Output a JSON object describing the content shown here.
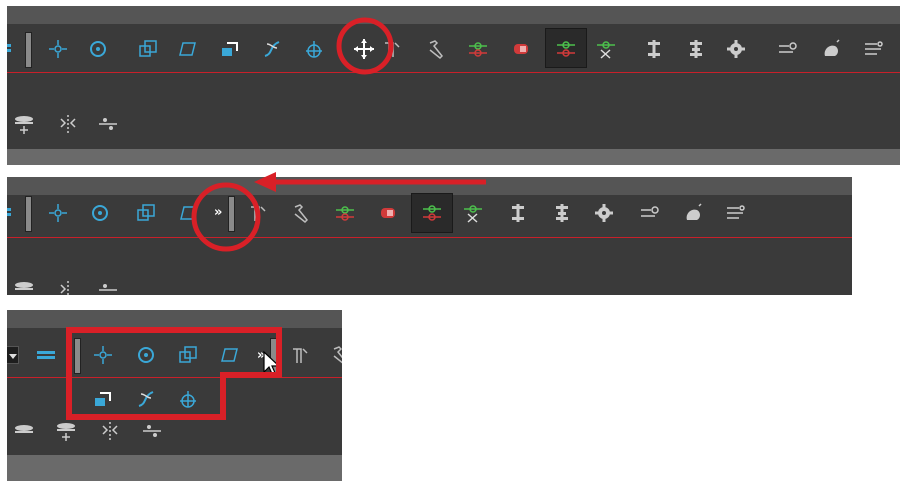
{
  "toolbar": {
    "overflow_chevron": "»"
  },
  "icons": {
    "row1": [
      "stack-icon",
      "grip-handle",
      "pivot-move-icon",
      "rotate-icon",
      "scale-icon",
      "skew-icon",
      "transform-3d-icon",
      "spline-offset-icon",
      "reposition-all-icon",
      "transform-move-icon",
      "bone-icon",
      "hammer-icon",
      "rigging-green-icon",
      "rigging-red-icon",
      "active-rigging-icon",
      "rigging-x-icon",
      "spine-1-icon",
      "spine-2-icon",
      "gear-spine-icon",
      "slider-icon",
      "blob-icon",
      "settings-lines-icon"
    ],
    "row2": [
      "layer-add-icon",
      "split-icon",
      "swap-icon"
    ]
  },
  "colors": {
    "panel_bg": "#3a3a3a",
    "accent_red": "#d92027",
    "icon_cyan": "#3aa8d8",
    "icon_green": "#4cc04c",
    "icon_red": "#d13a3a",
    "icon_grey": "#bdbdbd"
  }
}
